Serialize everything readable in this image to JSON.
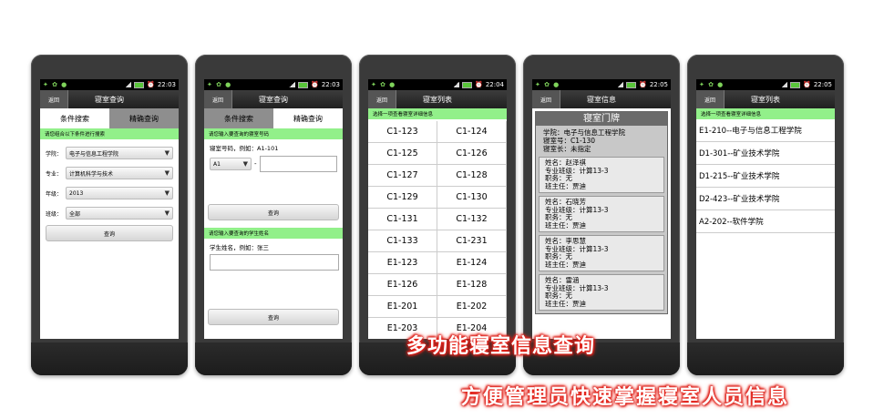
{
  "status_times": [
    "22:03",
    "22:03",
    "22:04",
    "22:05",
    "22:05"
  ],
  "back_label": "返回",
  "screen1": {
    "title": "寝室查询",
    "tabs": [
      "条件搜索",
      "精确查询"
    ],
    "hint": "请您组合以下条件进行搜索",
    "fields": [
      {
        "label": "学院：",
        "value": "电子与信息工程学院"
      },
      {
        "label": "专业：",
        "value": "计算机科学与技术"
      },
      {
        "label": "年级：",
        "value": "2013"
      },
      {
        "label": "班级：",
        "value": "全部"
      }
    ],
    "query_button": "查询"
  },
  "screen2": {
    "title": "寝室查询",
    "tabs": [
      "条件搜索",
      "精确查询"
    ],
    "room_hint": "请您输入要查询的寝室号码",
    "room_example": "寝室号码，例如：A1-101",
    "building_value": "A1",
    "dash": "-",
    "room_input": "",
    "query_button1": "查询",
    "student_hint": "请您输入要查询的学生姓名",
    "student_example": "学生姓名，例如：张三",
    "student_input": "",
    "query_button2": "查询"
  },
  "screen3": {
    "title": "寝室列表",
    "hint": "选择一项查看寝室详细信息",
    "rooms": [
      "C1-123",
      "C1-124",
      "C1-125",
      "C1-126",
      "C1-127",
      "C1-128",
      "C1-129",
      "C1-130",
      "C1-131",
      "C1-132",
      "C1-133",
      "C1-231",
      "E1-123",
      "E1-124",
      "E1-126",
      "E1-128",
      "E1-201",
      "E1-202",
      "E1-203",
      "E1-204"
    ]
  },
  "screen4": {
    "title": "寝室信息",
    "card_title": "寝室门牌",
    "info": [
      "学院：电子与信息工程学院",
      "寝室号：C1-130",
      "寝室长：未指定"
    ],
    "students": [
      [
        "姓名：赵泽祺",
        "专业班级：计算13-3",
        "职务：无",
        "班主任：贾迪"
      ],
      [
        "姓名：石晓芳",
        "专业班级：计算13-3",
        "职务：无",
        "班主任：贾迪"
      ],
      [
        "姓名：李思慧",
        "专业班级：计算13-3",
        "职务：无",
        "班主任：贾迪"
      ],
      [
        "姓名：雷涵",
        "专业班级：计算13-3",
        "职务：无",
        "班主任：贾迪"
      ]
    ]
  },
  "screen5": {
    "title": "寝室列表",
    "hint": "选择一项查看寝室详细信息",
    "rooms": [
      "E1-210--电子与信息工程学院",
      "D1-301--矿业技术学院",
      "D1-215--矿业技术学院",
      "D2-423--矿业技术学院",
      "A2-202--软件学院"
    ]
  },
  "banner": {
    "line1": "多功能寝室信息查询",
    "line2": "方便管理员快速掌握寝室人员信息"
  },
  "colors": {
    "accent_green": "#92f08a",
    "phone_body": "#3a3a3a",
    "banner_glow": "#e7251b"
  }
}
